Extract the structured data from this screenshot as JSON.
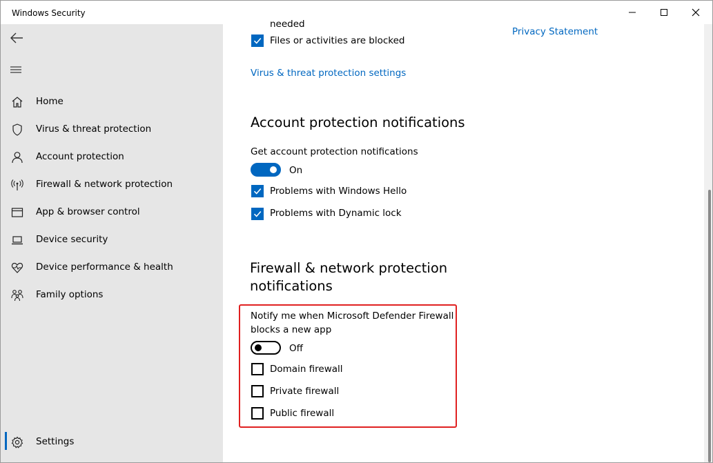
{
  "window": {
    "title": "Windows Security",
    "minimize_glyph": "—",
    "maximize_glyph": "☐",
    "close_glyph": "✕"
  },
  "sidebar": {
    "back_icon": "back-arrow-icon",
    "menu_icon": "hamburger-menu-icon",
    "items": [
      {
        "label": "Home",
        "icon": "home-icon"
      },
      {
        "label": "Virus & threat protection",
        "icon": "shield-icon"
      },
      {
        "label": "Account protection",
        "icon": "person-icon"
      },
      {
        "label": "Firewall & network protection",
        "icon": "wifi-antenna-icon"
      },
      {
        "label": "App & browser control",
        "icon": "browser-window-icon"
      },
      {
        "label": "Device security",
        "icon": "laptop-icon"
      },
      {
        "label": "Device performance & health",
        "icon": "heart-pulse-icon"
      },
      {
        "label": "Family options",
        "icon": "family-icon"
      }
    ],
    "settings": {
      "label": "Settings",
      "icon": "gear-icon",
      "selected": true
    }
  },
  "main": {
    "cut_off_text": "needed",
    "files_blocked": {
      "label": "Files or activities are blocked",
      "checked": true
    },
    "virus_settings_link": "Virus & threat protection settings",
    "privacy_link": "Privacy Statement",
    "account_section": {
      "heading": "Account protection notifications",
      "description": "Get account protection notifications",
      "toggle_state": "On",
      "toggle_on": true,
      "options": [
        {
          "label": "Problems with Windows Hello",
          "checked": true
        },
        {
          "label": "Problems with Dynamic lock",
          "checked": true
        }
      ]
    },
    "firewall_section": {
      "heading_line1": "Firewall & network protection",
      "heading_line2": "notifications",
      "description_line1": "Notify me when Microsoft Defender Firewall",
      "description_line2": "blocks a new app",
      "toggle_state": "Off",
      "toggle_on": false,
      "options": [
        {
          "label": "Domain firewall",
          "checked": false
        },
        {
          "label": "Private firewall",
          "checked": false
        },
        {
          "label": "Public firewall",
          "checked": false
        }
      ]
    }
  },
  "colors": {
    "accent": "#0067c0",
    "highlight_border": "#e02020",
    "sidebar_bg": "#e6e6e6"
  }
}
